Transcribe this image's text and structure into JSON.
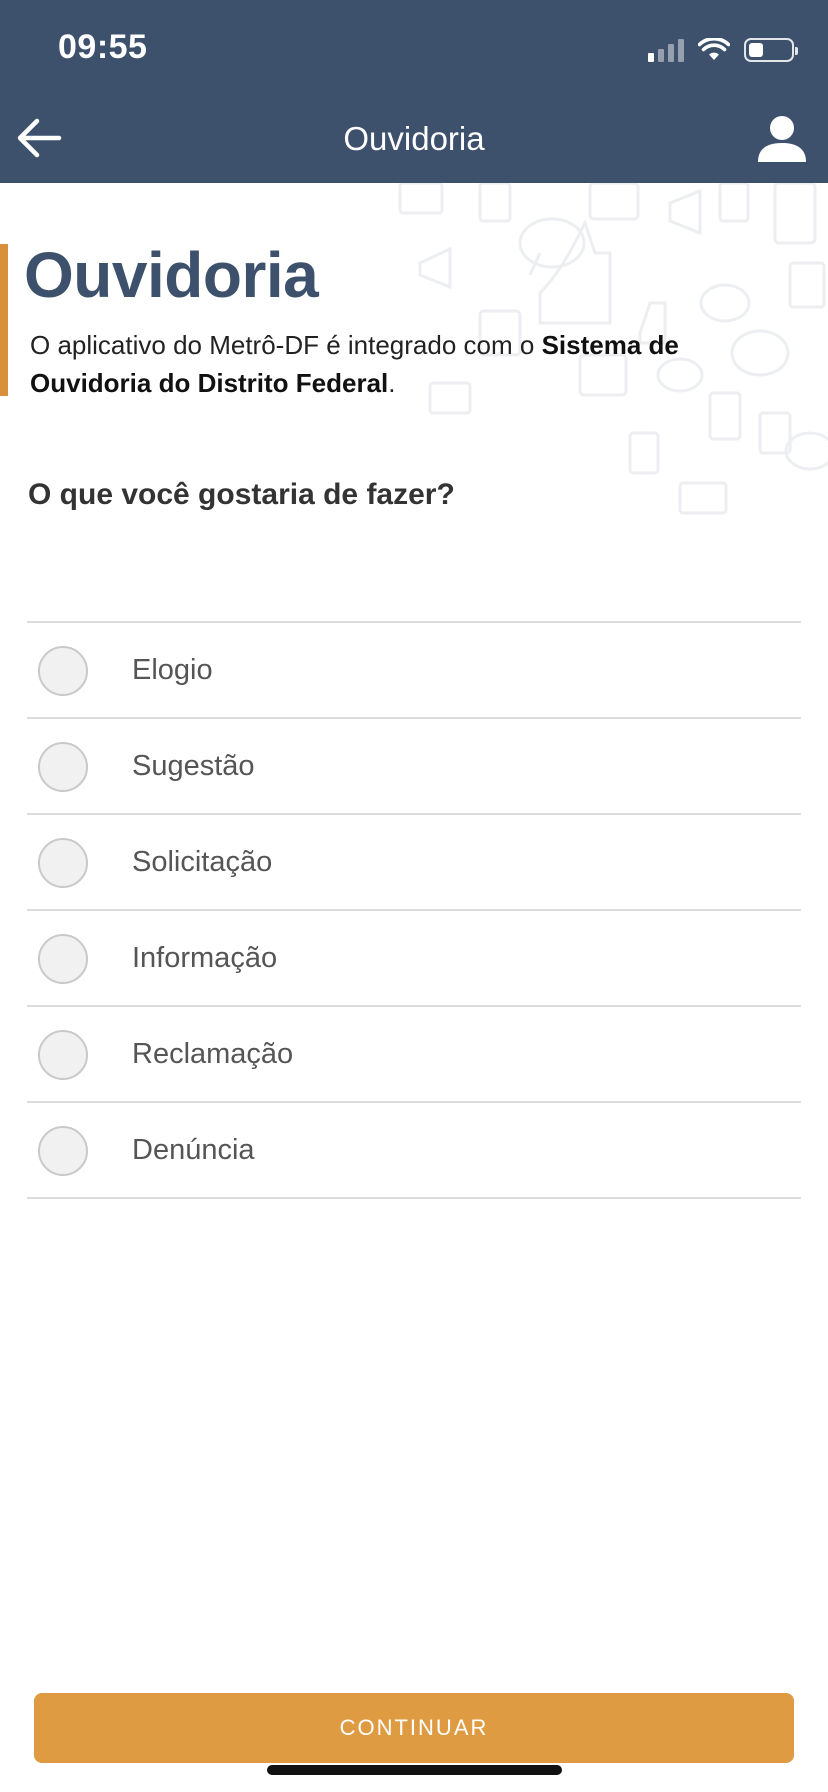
{
  "status_bar": {
    "time": "09:55"
  },
  "header": {
    "title": "Ouvidoria",
    "back_icon": "arrow-left-icon",
    "profile_icon": "user-icon"
  },
  "intro": {
    "title": "Ouvidoria",
    "text_prefix": "O aplicativo do Metrô-DF é integrado com o ",
    "text_bold": "Sistema de Ouvidoria do Distrito Federal",
    "text_suffix": "."
  },
  "question": "O que você gostaria de fazer?",
  "options": [
    {
      "label": "Elogio",
      "selected": false
    },
    {
      "label": "Sugestão",
      "selected": false
    },
    {
      "label": "Solicitação",
      "selected": false
    },
    {
      "label": "Informação",
      "selected": false
    },
    {
      "label": "Reclamação",
      "selected": false
    },
    {
      "label": "Denúncia",
      "selected": false
    }
  ],
  "continue_button": "CONTINUAR",
  "colors": {
    "header_bg": "#3e516c",
    "title": "#3e516c",
    "accent": "#d8913a",
    "button": "#de9b42"
  }
}
